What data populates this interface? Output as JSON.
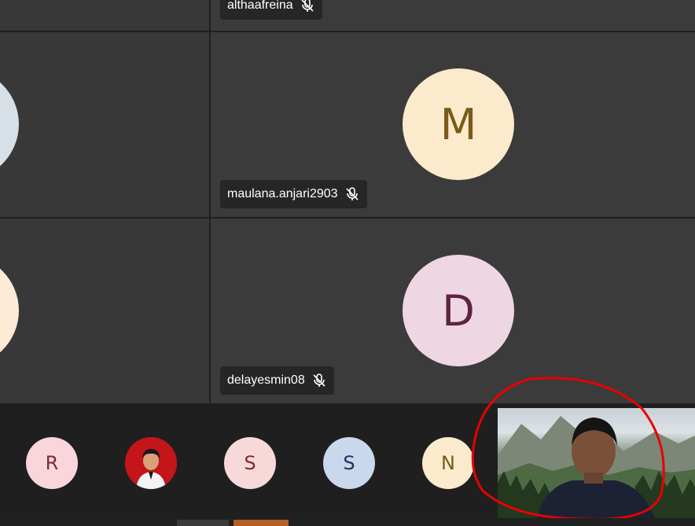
{
  "participants": {
    "top_name": "althaafreina",
    "middle": {
      "initial": "M",
      "name": "maulana.anjari2903",
      "color": "#fbeacb",
      "text_color": "#7a5a1a"
    },
    "bottom": {
      "initial": "D",
      "name": "delayesmin08",
      "color": "#efd6e3",
      "text_color": "#5e2340"
    }
  },
  "strip": [
    {
      "initial": "R",
      "color": "#f8d6dc",
      "text_color": "#7c2b3f"
    },
    {
      "initial": "",
      "color": "#c3151a",
      "text_color": "#ffffff"
    },
    {
      "initial": "S",
      "color": "#f7d9da",
      "text_color": "#7c2b3f"
    },
    {
      "initial": "S",
      "color": "#c9d8ec",
      "text_color": "#1b3460"
    },
    {
      "initial": "N",
      "color": "#fbeacb",
      "text_color": "#7a5a1a"
    }
  ],
  "colors": {
    "annotation": "#e80000",
    "taskbar_accent": "#b55f25"
  }
}
